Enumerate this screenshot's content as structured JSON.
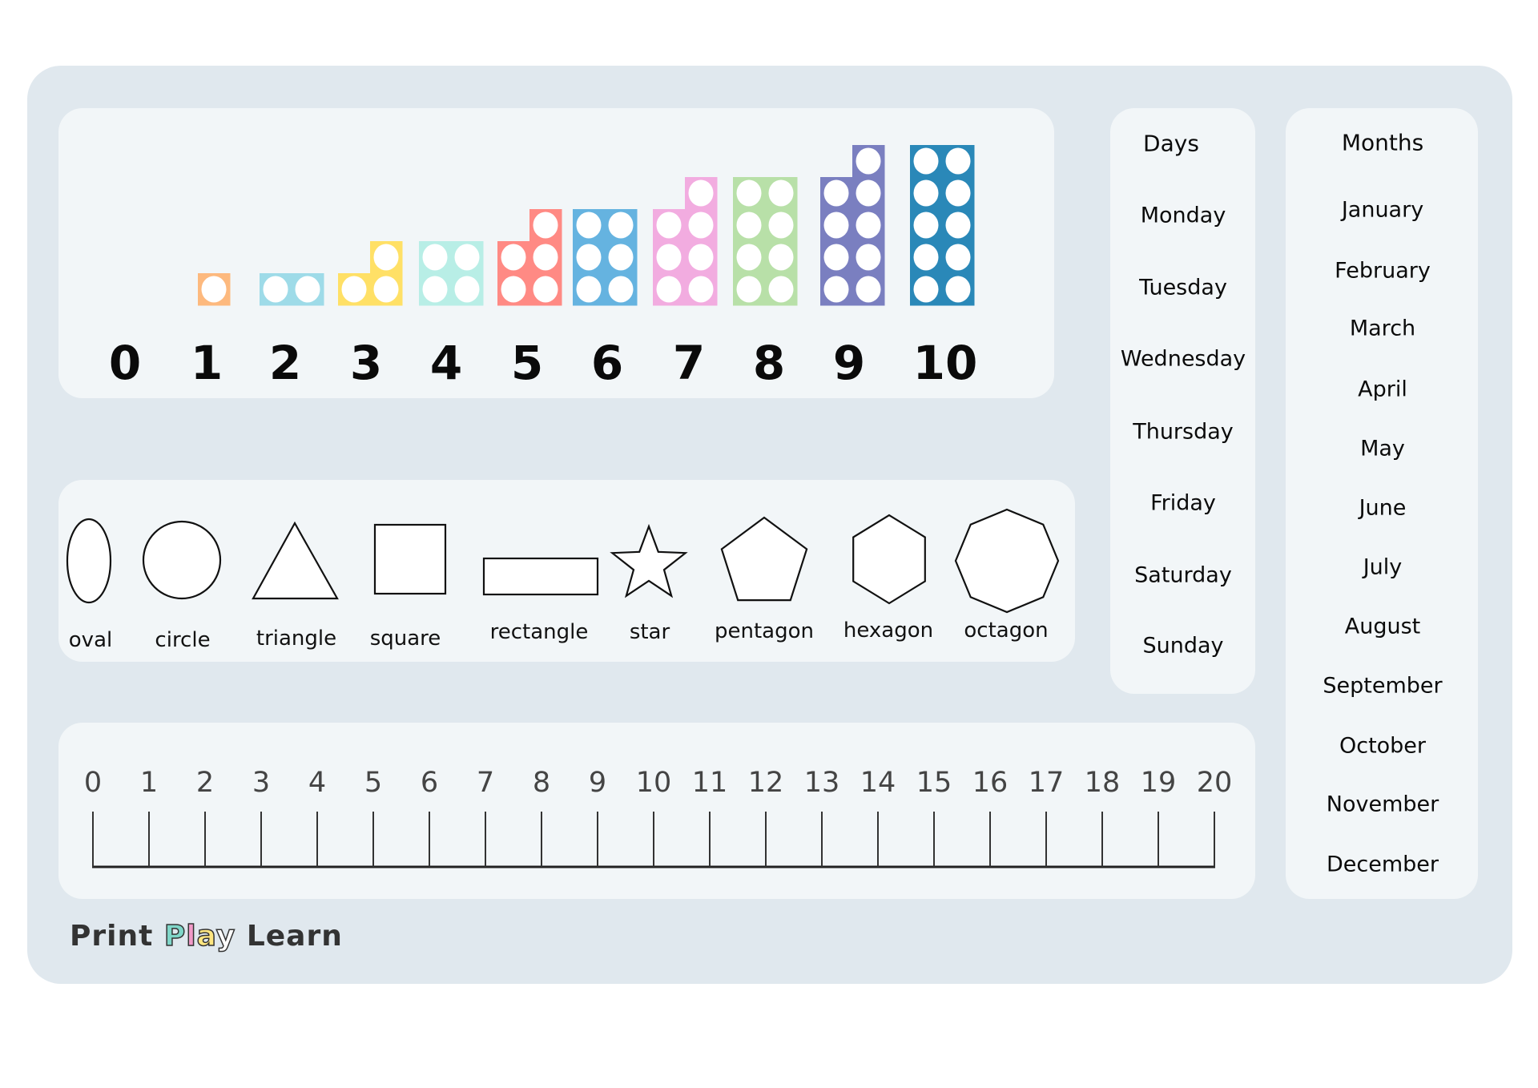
{
  "numbers_section": {
    "labels": [
      "0",
      "1",
      "2",
      "3",
      "4",
      "5",
      "6",
      "7",
      "8",
      "9",
      "10"
    ],
    "blocks": [
      {
        "value": 1,
        "color": "#FDB97E"
      },
      {
        "value": 2,
        "color": "#9EDBE8"
      },
      {
        "value": 3,
        "color": "#FFE066"
      },
      {
        "value": 4,
        "color": "#B8EEE6"
      },
      {
        "value": 5,
        "color": "#FF8A84"
      },
      {
        "value": 6,
        "color": "#65B3E0"
      },
      {
        "value": 7,
        "color": "#F2ACE0"
      },
      {
        "value": 8,
        "color": "#B8E0A8"
      },
      {
        "value": 9,
        "color": "#7A7FC0"
      },
      {
        "value": 10,
        "color": "#2A88B8"
      }
    ]
  },
  "shapes_section": {
    "shapes": [
      {
        "name": "oval",
        "label": "oval"
      },
      {
        "name": "circle",
        "label": "circle"
      },
      {
        "name": "triangle",
        "label": "triangle"
      },
      {
        "name": "square",
        "label": "square"
      },
      {
        "name": "rectangle",
        "label": "rectangle"
      },
      {
        "name": "star",
        "label": "star"
      },
      {
        "name": "pentagon",
        "label": "pentagon"
      },
      {
        "name": "hexagon",
        "label": "hexagon"
      },
      {
        "name": "octagon",
        "label": "octagon"
      }
    ]
  },
  "number_line": {
    "min": 0,
    "max": 20,
    "labels": [
      "0",
      "1",
      "2",
      "3",
      "4",
      "5",
      "6",
      "7",
      "8",
      "9",
      "10",
      "11",
      "12",
      "13",
      "14",
      "15",
      "16",
      "17",
      "18",
      "19",
      "20"
    ]
  },
  "days": {
    "title": "Days",
    "items": [
      "Monday",
      "Tuesday",
      "Wednesday",
      "Thursday",
      "Friday",
      "Saturday",
      "Sunday"
    ]
  },
  "months": {
    "title": "Months",
    "items": [
      "January",
      "February",
      "March",
      "April",
      "May",
      "June",
      "July",
      "August",
      "September",
      "October",
      "November",
      "December"
    ]
  },
  "logo": {
    "part1": "Print",
    "part2_letters": [
      "P",
      "l",
      "a",
      "y"
    ],
    "part2_colors": [
      "#7FD6C8",
      "#F29AC8",
      "#FFE680",
      "#FFFFFF"
    ],
    "part3": "Learn"
  }
}
